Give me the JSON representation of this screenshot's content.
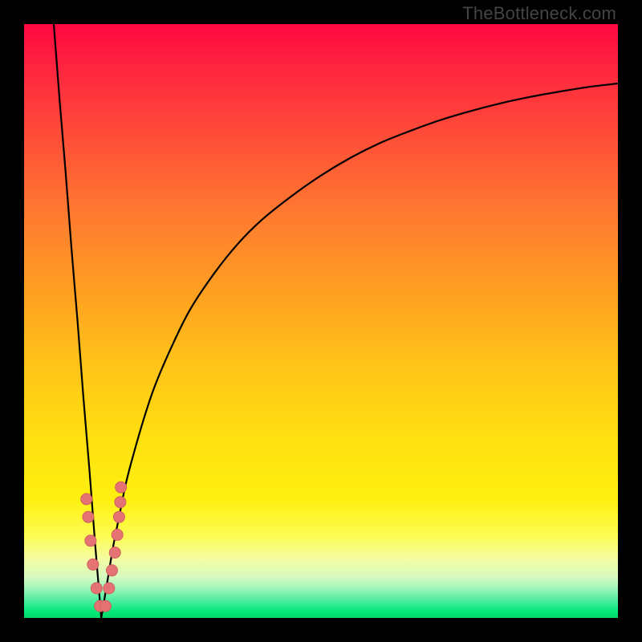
{
  "watermark_text": "TheBottleneck.com",
  "colors": {
    "frame": "#000000",
    "curve": "#000000",
    "points_fill": "#e57373",
    "points_stroke": "#d06060",
    "gradient_stops": [
      "#ff0740",
      "#ff2040",
      "#ff4a39",
      "#ff7a30",
      "#ffa220",
      "#ffc518",
      "#ffe010",
      "#fff010",
      "#fcfc50",
      "#f4fca0",
      "#d8fac0",
      "#a0f5b8",
      "#50eda0",
      "#00e878",
      "#00d868"
    ]
  },
  "chart_data": {
    "type": "line",
    "title": "",
    "xlabel": "",
    "ylabel": "",
    "x_range": [
      0,
      100
    ],
    "y_range": [
      0,
      100
    ],
    "minimum_x": 13,
    "series": [
      {
        "name": "bottleneck-curve",
        "comment": "y values are the curve height (0=bottom of plot, 100=top). Curve drops linearly from (5,100) to a minimum near x≈13 then rises along a concave-down arc toward ~90 at x=100.",
        "x": [
          5,
          6,
          7,
          8,
          9,
          10,
          11,
          12,
          13,
          14,
          15,
          16,
          17,
          18,
          20,
          22,
          25,
          28,
          32,
          36,
          40,
          45,
          50,
          55,
          60,
          65,
          70,
          75,
          80,
          85,
          90,
          95,
          100
        ],
        "y": [
          100,
          87,
          75,
          62,
          50,
          37,
          25,
          12,
          0,
          6,
          12,
          17,
          22,
          26,
          33,
          39,
          46,
          52,
          58,
          63,
          67,
          71,
          74.5,
          77.5,
          80,
          82,
          83.8,
          85.3,
          86.6,
          87.7,
          88.6,
          89.4,
          90
        ]
      }
    ],
    "scatter_points": {
      "name": "highlighted-points",
      "comment": "Salmon dots clustered around the dip of the curve.",
      "x": [
        10.5,
        10.8,
        11.2,
        11.6,
        12.2,
        12.8,
        13.7,
        14.3,
        14.8,
        15.3,
        15.7,
        16.0,
        16.2,
        16.3
      ],
      "y": [
        20,
        17,
        13,
        9,
        5,
        2,
        2,
        5,
        8,
        11,
        14,
        17,
        19.5,
        22
      ]
    }
  }
}
